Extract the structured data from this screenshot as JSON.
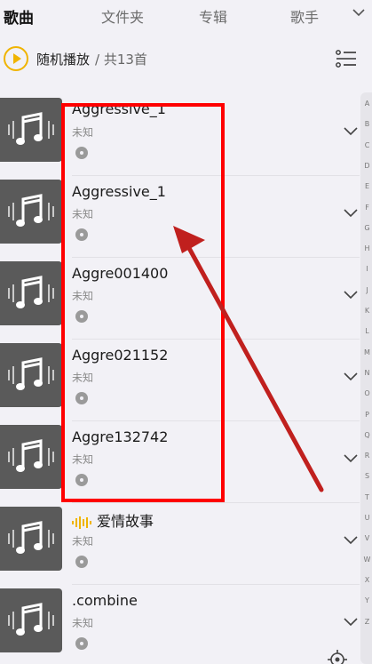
{
  "tabs": [
    {
      "label": "歌曲",
      "active": true
    },
    {
      "label": "文件夹",
      "active": false
    },
    {
      "label": "专辑",
      "active": false
    },
    {
      "label": "歌手",
      "active": false
    }
  ],
  "playbar": {
    "shuffle_label": "随机播放",
    "count_label": "/ 共13首"
  },
  "songs": [
    {
      "title": "Aggressive_1",
      "artist": "未知"
    },
    {
      "title": "Aggressive_1",
      "artist": "未知"
    },
    {
      "title": "Aggre001400",
      "artist": "未知"
    },
    {
      "title": "Aggre021152",
      "artist": "未知"
    },
    {
      "title": "Aggre132742",
      "artist": "未知"
    },
    {
      "title": "爱情故事",
      "artist": "未知",
      "playing": true
    },
    {
      "title": ".combine",
      "artist": "未知"
    }
  ],
  "index_letters": [
    "A",
    "B",
    "C",
    "D",
    "E",
    "F",
    "G",
    "H",
    "I",
    "J",
    "K",
    "L",
    "M",
    "N",
    "O",
    "P",
    "Q",
    "R",
    "S",
    "T",
    "U",
    "V",
    "W",
    "X",
    "Y",
    "Z"
  ],
  "colors": {
    "accent": "#f0b400",
    "annotation": "#ff0000",
    "arrow": "#c0201e"
  },
  "icons": {
    "play": "play-icon",
    "list_menu": "list-menu-icon",
    "cover": "music-note-icon",
    "disc": "disc-icon",
    "expand": "chevron-down-icon",
    "locate": "locate-icon"
  }
}
